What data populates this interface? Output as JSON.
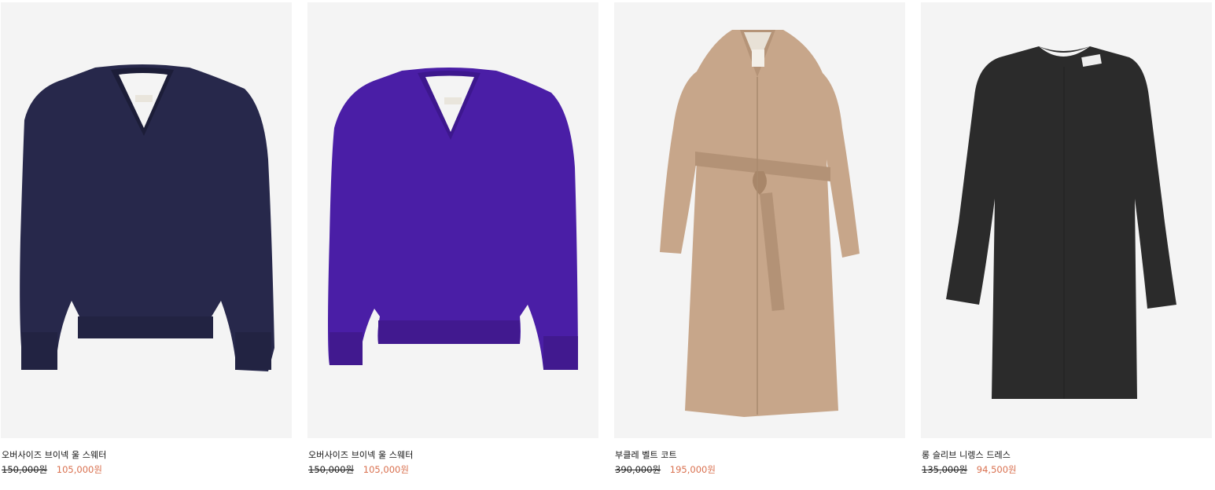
{
  "products": [
    {
      "name": "오버사이즈 브이넥 울 스웨터",
      "original_price": "150,000원",
      "sale_price": "105,000원",
      "image": "navy-v-neck-sweater",
      "color": "#27284b"
    },
    {
      "name": "오버사이즈 브이넥 울 스웨터",
      "original_price": "150,000원",
      "sale_price": "105,000원",
      "image": "purple-v-neck-sweater",
      "color": "#4a1ea6"
    },
    {
      "name": "부클레 벨트 코트",
      "original_price": "390,000원",
      "sale_price": "195,000원",
      "image": "beige-boucle-belted-coat",
      "color": "#c7a68a"
    },
    {
      "name": "롱 슬리브 니렝스 드레스",
      "original_price": "135,000원",
      "sale_price": "94,500원",
      "image": "black-long-sleeve-dress",
      "color": "#2b2b2b"
    }
  ],
  "colors": {
    "sale_price": "#d9704f",
    "image_background": "#f4f4f4"
  }
}
